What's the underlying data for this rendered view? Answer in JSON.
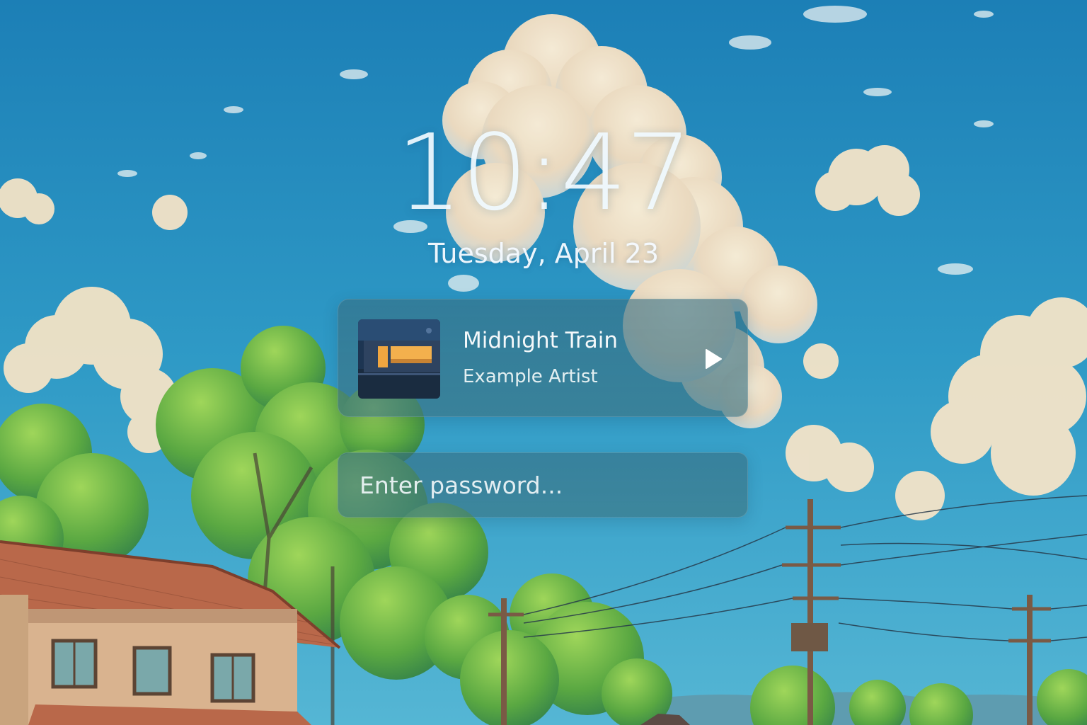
{
  "lock_screen": {
    "time": "10:47",
    "date": "Tuesday, April 23"
  },
  "media": {
    "track_title": "Midnight Train",
    "artist": "Example Artist",
    "play_icon": "play-icon"
  },
  "password": {
    "placeholder": "Enter password..."
  },
  "colors": {
    "sky_top": "#1f82b8",
    "sky_bottom": "#3fa9cf",
    "card_tint": "#3c7384",
    "text": "#f4f8fa"
  }
}
